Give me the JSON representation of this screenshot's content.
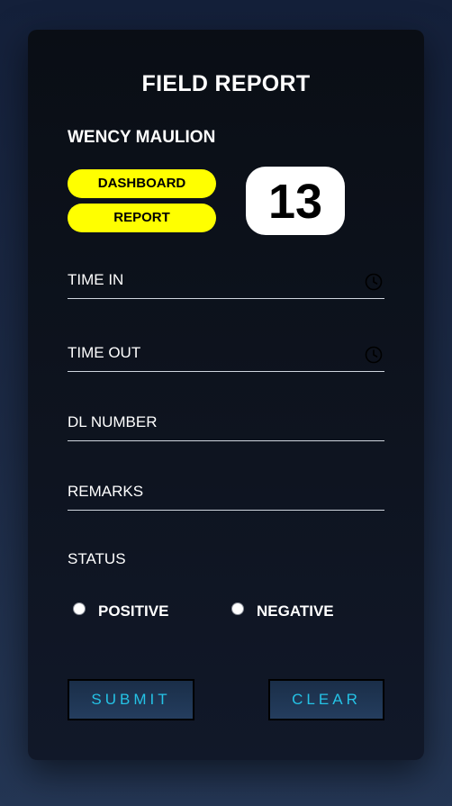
{
  "form": {
    "title": "FIELD REPORT",
    "username": "WENCY MAULION",
    "nav": {
      "dashboard_label": "DASHBOARD",
      "report_label": "REPORT"
    },
    "counter": "13",
    "fields": {
      "time_in": {
        "label": "TIME IN",
        "icon": "clock-icon"
      },
      "time_out": {
        "label": "TIME OUT",
        "icon": "clock-icon"
      },
      "dl_number": {
        "label": "DL NUMBER"
      },
      "remarks": {
        "label": "REMARKS"
      }
    },
    "status": {
      "label": "STATUS",
      "options": [
        "POSITIVE",
        "NEGATIVE"
      ],
      "selected": null
    },
    "actions": {
      "submit_label": "SUBMIT",
      "clear_label": "CLEAR"
    }
  },
  "colors": {
    "pill_bg": "#ffff00",
    "button_text": "#25c3e6",
    "card_bg": "#0c111b",
    "page_bg": "#1c2a45"
  }
}
